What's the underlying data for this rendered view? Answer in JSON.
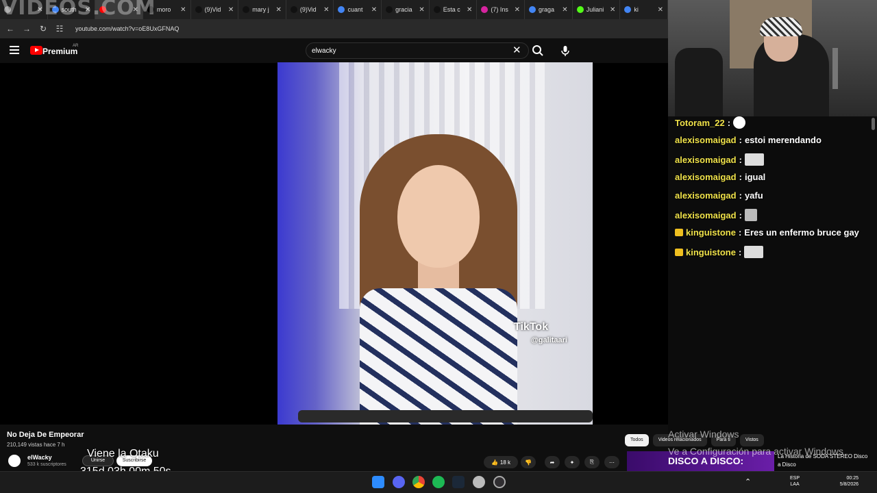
{
  "watermark": "VIDEOS.COM",
  "browser": {
    "tabs": [
      {
        "label": "",
        "icon": "gear-icon",
        "color": "#888888"
      },
      {
        "label": "south",
        "icon": "google-icon",
        "color": "#4285f4"
      },
      {
        "label": "",
        "icon": "youtube-icon",
        "color": "#ff0000",
        "active": true
      },
      {
        "label": "moro",
        "icon": "x-icon",
        "color": "#000000"
      },
      {
        "label": "(9)Vid",
        "icon": "tiktok-icon",
        "color": "#111111"
      },
      {
        "label": "mary j",
        "icon": "tiktok-icon",
        "color": "#111111"
      },
      {
        "label": "(9)Vid",
        "icon": "tiktok-icon",
        "color": "#111111"
      },
      {
        "label": "cuant",
        "icon": "google-icon",
        "color": "#4285f4"
      },
      {
        "label": "gracia",
        "icon": "tiktok-icon",
        "color": "#111111"
      },
      {
        "label": "Esta c",
        "icon": "tiktok-icon",
        "color": "#111111"
      },
      {
        "label": "(7) Ins",
        "icon": "instagram-icon",
        "color": "#d6249f"
      },
      {
        "label": "graga",
        "icon": "google-icon",
        "color": "#4285f4"
      },
      {
        "label": "Juliani",
        "icon": "kick-icon",
        "color": "#53fc18"
      },
      {
        "label": "ki",
        "icon": "google-icon",
        "color": "#4285f4"
      }
    ],
    "url": "youtube.com/watch?v=oE8UxGFNAQ"
  },
  "youtube": {
    "brand": "Premium",
    "region": "AR",
    "search_value": "elwacky"
  },
  "video": {
    "tiktok_logo": "TikTok",
    "tiktok_user": "@galitaari",
    "title": "No Deja De Empeorar",
    "meta": "210,149 vistas  hace 7 h",
    "channel": "elWacky",
    "subscribers": "533 k suscriptores",
    "join_label": "Unirse",
    "subscribe_label": "Suscribirse",
    "likes": "18 k"
  },
  "stream_overlay": {
    "line1": "Viene la Otaku",
    "line2": "315d 03h 00m 50s"
  },
  "chat": [
    {
      "user": "Totoram_22",
      "text": "",
      "emote": "smile",
      "crown": false
    },
    {
      "user": "alexisomaigad",
      "text": "estoi merendando",
      "emote": "",
      "crown": false
    },
    {
      "user": "alexisomaigad",
      "text": "",
      "emote": "wide",
      "crown": false
    },
    {
      "user": "alexisomaigad",
      "text": "igual",
      "emote": "",
      "crown": false
    },
    {
      "user": "alexisomaigad",
      "text": "yafu",
      "emote": "",
      "crown": false
    },
    {
      "user": "alexisomaigad",
      "text": "",
      "emote": "small",
      "crown": false
    },
    {
      "user": "kinguistone",
      "text": "Eres un enfermo bruce gay",
      "emote": "",
      "crown": true
    },
    {
      "user": "kinguistone",
      "text": "",
      "emote": "wide",
      "crown": true
    }
  ],
  "chips": [
    "Todos",
    "Videos relacionados",
    "Para ti",
    "Vistos"
  ],
  "windows_activation": {
    "line1": "Activar Windows",
    "line2": "Ve a Configuración para activar Windows"
  },
  "recommended": {
    "thumb_text": "DISCO A DISCO:",
    "title": "La Historia de SODA STEREO Disco a Disco"
  },
  "taskbar": {
    "lang_top": "ESP",
    "lang_bottom": "LAA",
    "time": "00:25",
    "date": "5/8/2026"
  }
}
